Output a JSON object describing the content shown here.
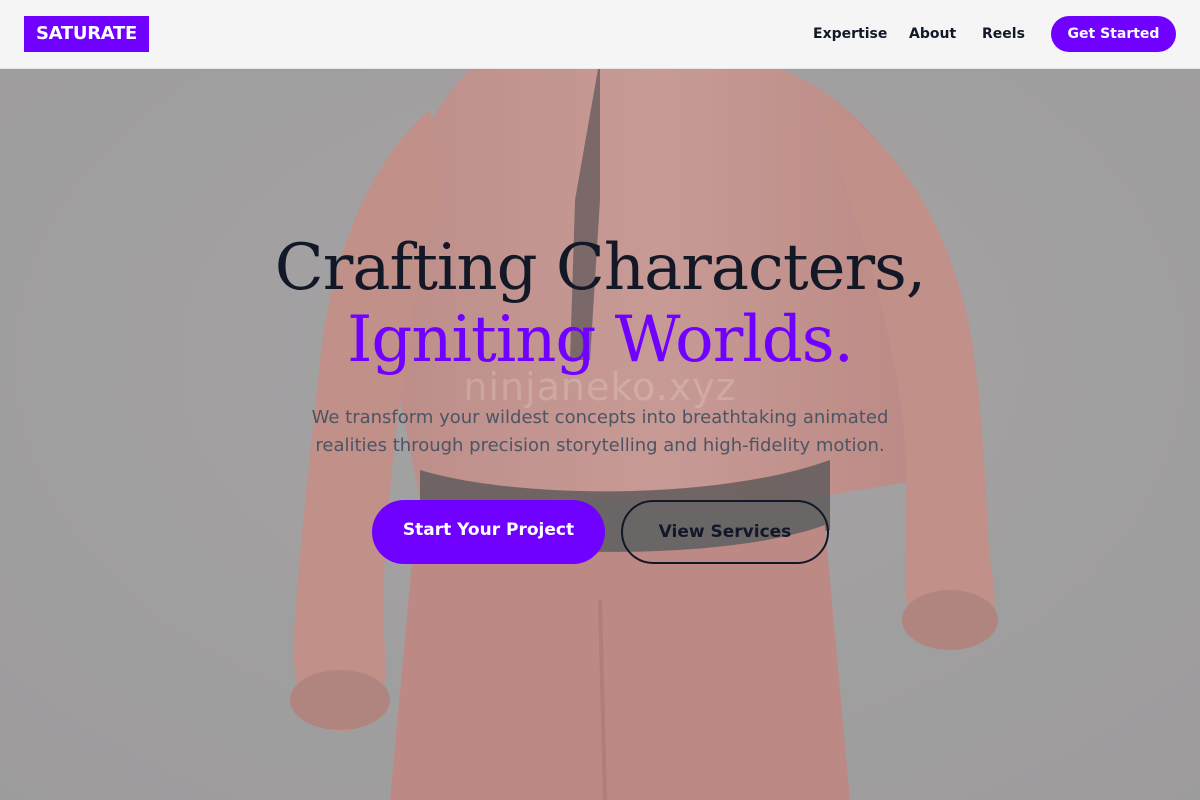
{
  "brand": {
    "logo_text": "SATURATE"
  },
  "nav": {
    "links": [
      "Expertise",
      "About",
      "Reels"
    ],
    "cta_label": "Get Started"
  },
  "hero": {
    "headline_line1": "Crafting Characters,",
    "headline_line2": "Igniting Worlds.",
    "watermark": "ninjaneko.xyz",
    "subtitle_line1": "We transform your wildest concepts into breathtaking animated",
    "subtitle_line2": "realities through precision storytelling and high-fidelity motion.",
    "primary_button": "Start Your Project",
    "secondary_button": "View Services"
  },
  "colors": {
    "accent": "#7000ff",
    "headline_dark": "#121826",
    "subtitle": "#4b5563",
    "background": "#a09e9f"
  },
  "images": {
    "hero_background": "red-character-back-render"
  }
}
